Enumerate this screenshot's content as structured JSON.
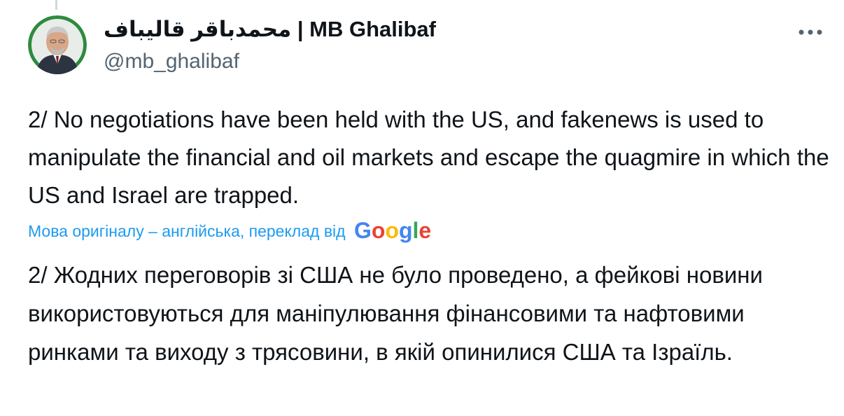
{
  "author": {
    "display_name": "محمدباقر قالیباف | MB Ghalibaf",
    "handle": "@mb_ghalibaf",
    "avatar_icon": "user-avatar"
  },
  "more_icon": "more-horizontal-icon",
  "tweet": {
    "text": "2/ No negotiations have been held with the US, and fakenews is used to manipulate the financial and oil markets and escape the quagmire in which the US and Israel are trapped."
  },
  "translation": {
    "label": "Мова оригіналу – англійська, переклад від",
    "provider": "Google",
    "text": "2/ Жодних переговорів зі США не було проведено, а фейкові новини використовуються для маніпулювання фінансовими та нафтовими ринками та виходу з трясовини, в якій опинилися США та Ізраїль."
  },
  "colors": {
    "link": "#1d9bf0",
    "secondary_text": "#536471",
    "primary_text": "#0f1419",
    "avatar_ring": "#2e8b3e"
  }
}
